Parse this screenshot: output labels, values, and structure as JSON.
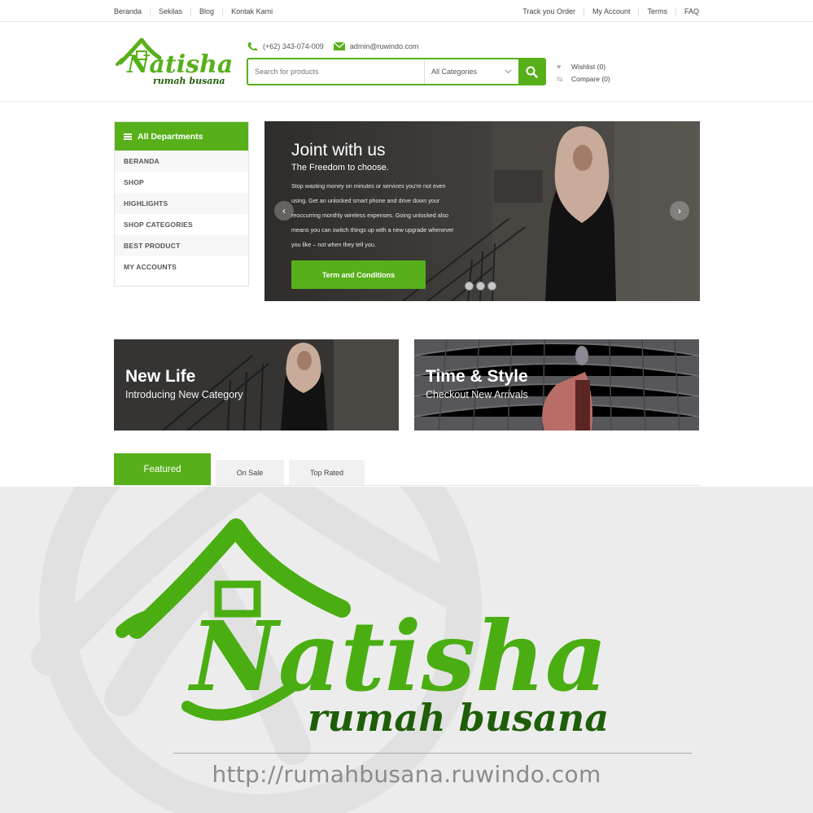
{
  "topbar": {
    "left_links": [
      "Beranda",
      "Sekilas",
      "Blog",
      "Kontak Kami"
    ],
    "right_links": [
      "Track you Order",
      "My Account",
      "Terms",
      "FAQ"
    ]
  },
  "header": {
    "logo_text": "Natisha",
    "logo_subtext": "rumah busana",
    "phone": "(+62) 343-074-009",
    "email": "admin@ruwindo.com",
    "search_placeholder": "Search for products",
    "category_select": "All Categories",
    "wishlist": "Wishlist (0)",
    "compare": "Compare (0)",
    "icons": [
      "phone-icon",
      "mail-icon",
      "search-icon",
      "heart-icon",
      "compare-icon",
      "chevron-down-icon"
    ]
  },
  "sidebar": {
    "title": "All Departments",
    "items": [
      {
        "label": "BERANDA"
      },
      {
        "label": "SHOP"
      },
      {
        "label": "HIGHLIGHTS"
      },
      {
        "label": "SHOP CATEGORIES"
      },
      {
        "label": "BEST PRODUCT"
      },
      {
        "label": "MY ACCOUNTS"
      }
    ]
  },
  "hero": {
    "title": "Joint with us",
    "subtitle": "The Freedom to choose.",
    "body_lines": [
      "Stop wasting money on minutes or services you're not even",
      "using. Get an unlocked smart phone and drive down your",
      "reoccurring monthly wireless expenses. Going unlocked also",
      "means you can switch things up with a new upgrade whenever",
      "you like – not when they tell you."
    ],
    "button": "Term and Conditions",
    "prev_arrow": "‹",
    "next_arrow": "›",
    "slide_count": 3
  },
  "banners": [
    {
      "title": "New Life",
      "subtitle": "Introducing New Category"
    },
    {
      "title": "Time & Style",
      "subtitle": "Checkout New Arrivals"
    }
  ],
  "tabs": [
    {
      "label": "Featured",
      "active": true
    },
    {
      "label": "On Sale",
      "active": false
    },
    {
      "label": "Top Rated",
      "active": false
    }
  ],
  "brand_panel": {
    "name": "Natisha",
    "tagline": "rumah busana",
    "url": "http://rumahbusana.ruwindo.com"
  },
  "colors": {
    "accent_green": "#57b01a",
    "dark_green": "#1f5e08",
    "panel_gray": "#ececec"
  }
}
